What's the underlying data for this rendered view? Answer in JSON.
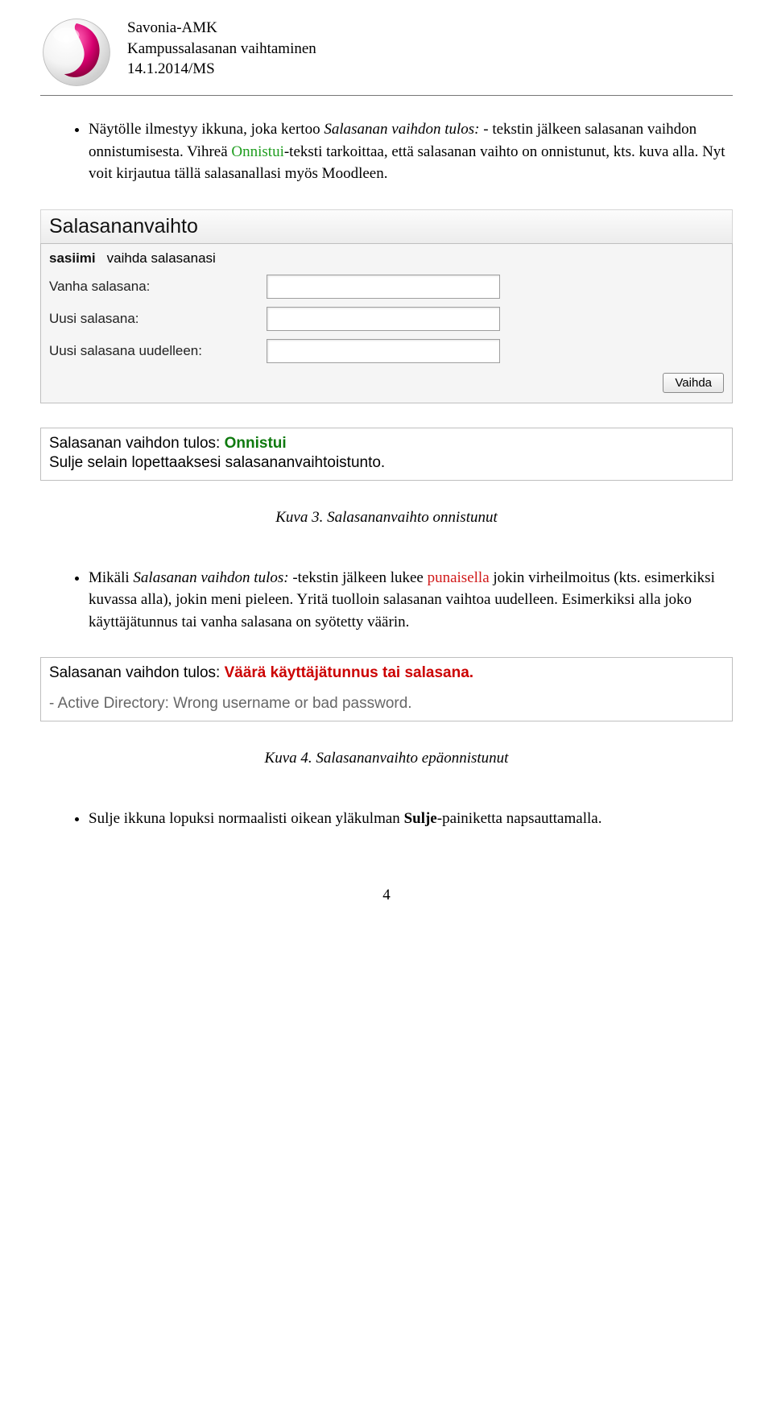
{
  "header": {
    "line1": "Savonia-AMK",
    "line2": "Kampussalasanan vaihtaminen",
    "line3": "14.1.2014/MS"
  },
  "bullet1": {
    "a": "Näytölle ilmestyy ikkuna, joka kertoo ",
    "b": "Salasanan vaihdon tulos: ",
    "c": "- tekstin jälkeen salasanan vaihdon onnistumisesta. Vihreä ",
    "d": "Onnistui",
    "e": "-teksti tarkoittaa, että salasanan vaihto on onnistunut, kts. kuva alla. Nyt voit kirjautua tällä salasanallasi myös Moodleen."
  },
  "shot1": {
    "title": "Salasananvaihto",
    "user": "sasiimi",
    "instr": "vaihda salasanasi",
    "f1": "Vanha salasana:",
    "f2": "Uusi salasana:",
    "f3": "Uusi salasana uudelleen:",
    "button": "Vaihda"
  },
  "result1": {
    "prefix": "Salasanan vaihdon tulos: ",
    "status": "Onnistui",
    "line2": "Sulje selain lopettaaksesi salasananvaihtoistunto."
  },
  "caption1": "Kuva 3. Salasananvaihto onnistunut",
  "bullet2": {
    "a": "Mikäli ",
    "b": "Salasanan vaihdon tulos: ",
    "c": "-tekstin jälkeen lukee ",
    "d": "punaisella",
    "e": " jokin virheilmoitus (kts. esimerkiksi kuvassa alla), jokin meni pieleen. Yritä tuolloin salasanan vaihtoa uudelleen. Esimerkiksi alla joko käyttäjätunnus tai vanha salasana on syötetty väärin."
  },
  "result2": {
    "prefix": "Salasanan vaihdon tulos: ",
    "status": "Väärä käyttäjätunnus tai salasana.",
    "line2": "- Active Directory: Wrong username or bad password."
  },
  "caption2": "Kuva 4. Salasananvaihto epäonnistunut",
  "bullet3": {
    "a": "Sulje ikkuna lopuksi normaalisti oikean yläkulman ",
    "b": "Sulje",
    "c": "-painiketta napsauttamalla."
  },
  "page_number": "4"
}
